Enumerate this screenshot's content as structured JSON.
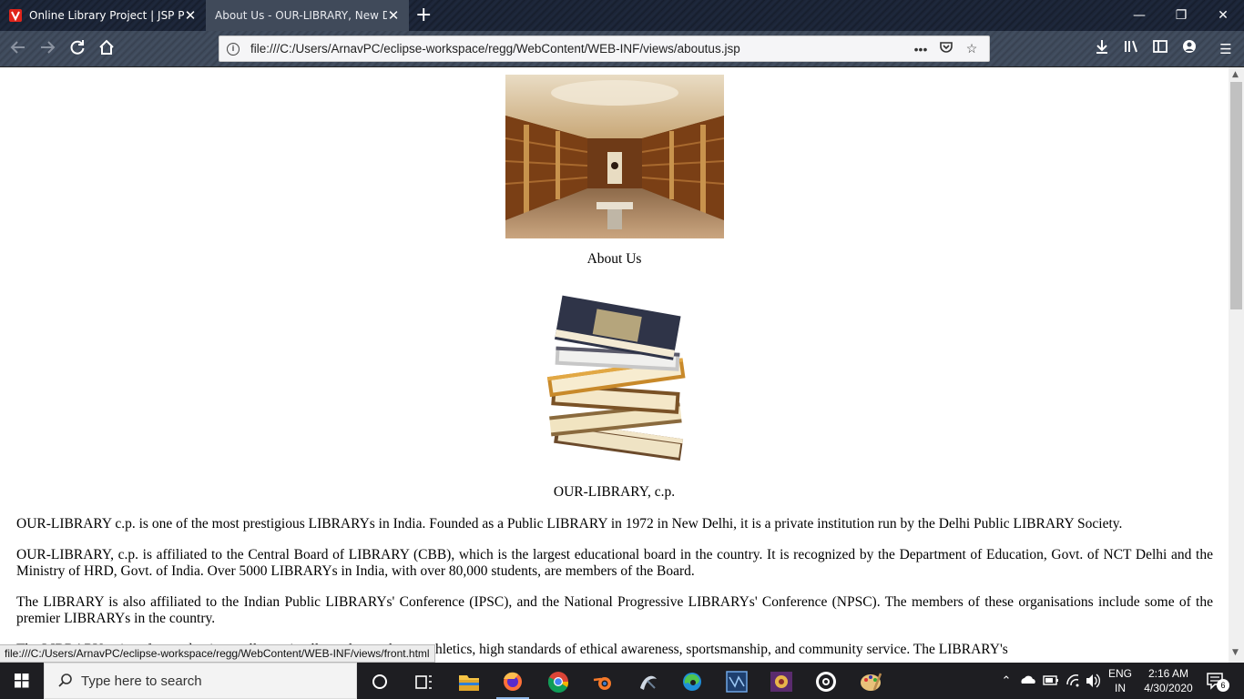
{
  "browser": {
    "tabs": [
      {
        "title": "Online Library Project | JSP Proj",
        "active": false
      },
      {
        "title": "About Us - OUR-LIBRARY, New Del",
        "active": true
      }
    ],
    "url": "file:///C:/Users/ArnavPC/eclipse-workspace/regg/WebContent/WEB-INF/views/aboutus.jsp",
    "status_link": "file:///C:/Users/ArnavPC/eclipse-workspace/regg/WebContent/WEB-INF/views/front.html",
    "page_actions_label": "•••"
  },
  "page": {
    "heading": "About Us",
    "subheading": "OUR-LIBRARY, c.p.",
    "paragraphs": [
      "OUR-LIBRARY c.p. is one of the most prestigious LIBRARYs in India. Founded as a Public LIBRARY in 1972 in New Delhi, it is a private institution run by the Delhi Public LIBRARY Society.",
      "OUR-LIBRARY, c.p. is affiliated to the Central Board of LIBRARY (CBB), which is the largest educational board in the country. It is recognized by the Department of Education, Govt. of NCT Delhi and the Ministry of HRD, Govt. of India. Over 5000 LIBRARYs in India, with over 80,000 students, are members of the Board.",
      "The LIBRARY is also affiliated to the Indian Public LIBRARYs' Conference (IPSC), and the National Progressive LIBRARYs' Conference (NPSC). The members of these organisations include some of the premier LIBRARYs in the country.",
      "The LIBRARY strives for academic excellence, intellectual growth, art, athletics, high standards of ethical awareness, sportsmanship, and community service. The LIBRARY's"
    ]
  },
  "taskbar": {
    "search_placeholder": "Type here to search",
    "language": "ENG",
    "region": "IN",
    "time": "2:16 AM",
    "date": "4/30/2020",
    "notifications": "6"
  },
  "icons": {
    "back": "arrow-left-icon",
    "forward": "arrow-right-icon",
    "reload": "reload-icon",
    "home": "home-icon"
  }
}
